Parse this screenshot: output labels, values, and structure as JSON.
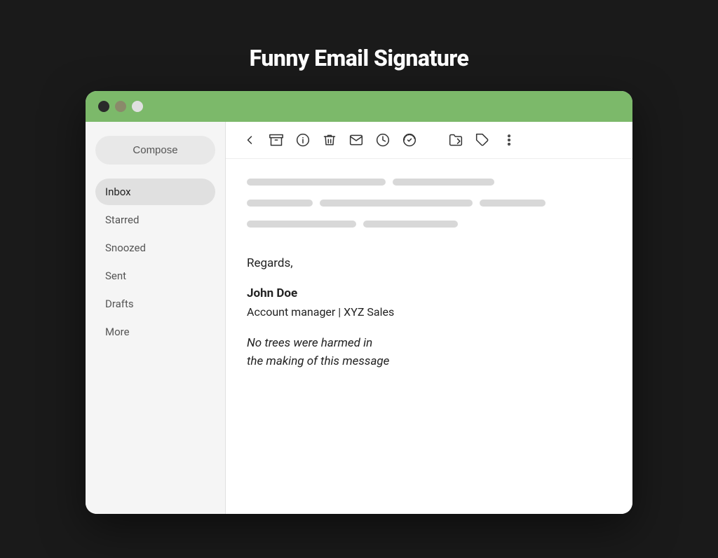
{
  "page": {
    "title": "Funny Email Signature"
  },
  "titlebar": {
    "dot1": "close",
    "dot2": "minimize",
    "dot3": "maximize"
  },
  "sidebar": {
    "compose_label": "Compose",
    "nav_items": [
      {
        "id": "inbox",
        "label": "Inbox",
        "active": true
      },
      {
        "id": "starred",
        "label": "Starred",
        "active": false
      },
      {
        "id": "snoozed",
        "label": "Snoozed",
        "active": false
      },
      {
        "id": "sent",
        "label": "Sent",
        "active": false
      },
      {
        "id": "drafts",
        "label": "Drafts",
        "active": false
      },
      {
        "id": "more",
        "label": "More",
        "active": false
      }
    ]
  },
  "toolbar": {
    "icons": [
      "back",
      "archive",
      "info",
      "delete",
      "mail",
      "clock",
      "check-circle",
      "folder-move",
      "label",
      "more-vertical"
    ]
  },
  "email": {
    "regards": "Regards,",
    "name": "John Doe",
    "title": "Account manager | XYZ Sales",
    "funny_line1": "No trees were harmed in",
    "funny_line2": "the making of this message"
  },
  "colors": {
    "titlebar": "#7cb96a",
    "background": "#1a1a1a",
    "window_bg": "#f5f5f5",
    "main_bg": "#ffffff"
  }
}
